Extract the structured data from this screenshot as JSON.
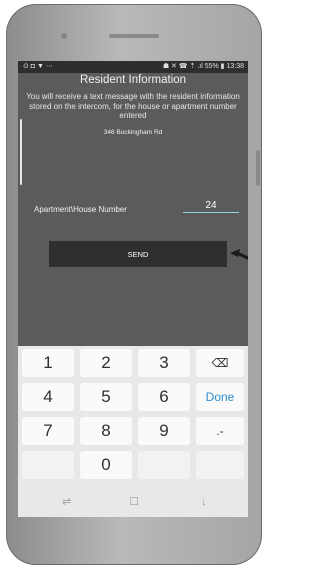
{
  "status_bar": {
    "left_icons": "⊙ ◘ ▼ ⋯",
    "right_text": "☗ ✕ ☎ ⇡ .ıl 55% ▮ 13:38"
  },
  "screen": {
    "title": "Resident Information",
    "description": "You will receive a text message with the resident information stored on the intercom, for the house or apartment number entered",
    "address": "346 Buckingham Rd",
    "apartment_label": "Apartment\\House Number",
    "apartment_value": "24",
    "send_label": "SEND"
  },
  "keyboard": {
    "rows": [
      [
        "1",
        "2",
        "3",
        "⌫"
      ],
      [
        "4",
        "5",
        "6",
        "Done"
      ],
      [
        "7",
        "8",
        "9",
        ".-"
      ],
      [
        "",
        "0",
        "",
        ""
      ]
    ]
  },
  "navbar": {
    "recent": "⇌",
    "home": "☐",
    "back": "↓"
  },
  "colors": {
    "screen_bg": "#5b5b5b",
    "button_bg": "#2f2f2f",
    "input_underline": "#8fd3d6",
    "done_key": "#2f8fd0"
  }
}
